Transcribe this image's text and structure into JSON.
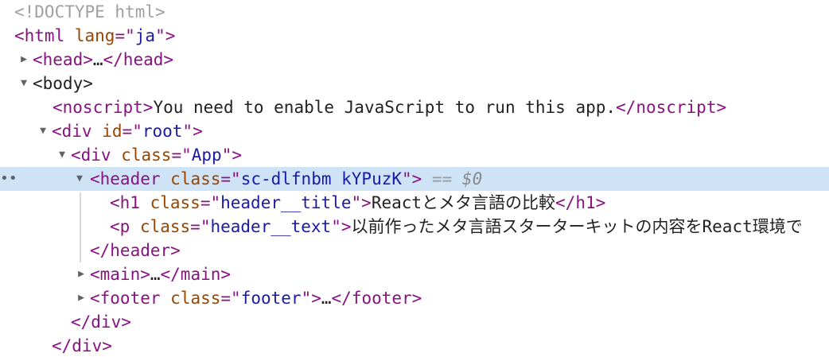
{
  "doctype": "<!DOCTYPE html>",
  "html_open": {
    "tag": "<html",
    "attr": "lang",
    "val": "ja",
    "close": ">"
  },
  "head": {
    "open": "<head>",
    "ellipsis": "…",
    "close": "</head>"
  },
  "body_open": "<body>",
  "noscript": {
    "open": "<noscript>",
    "text": "You need to enable JavaScript to run this app.",
    "close": "</noscript>"
  },
  "div_root": {
    "tag": "<div",
    "attr": "id",
    "val": "root",
    "close": ">"
  },
  "div_app": {
    "tag": "<div",
    "attr": "class",
    "val": "App",
    "close": ">"
  },
  "header": {
    "tag": "<header",
    "attr": "class",
    "val": "sc-dlfnbm kYPuzK",
    "close": ">",
    "eq": "==",
    "dollar": "$0",
    "dots": "••",
    "h1": {
      "tag": "<h1",
      "attr": "class",
      "val": "header__title",
      "gt": ">",
      "text": "Reactとメタ言語の比較",
      "close": "</h1>"
    },
    "p": {
      "tag": "<p",
      "attr": "class",
      "val": "header__text",
      "gt": ">",
      "text": "以前作ったメタ言語スターターキットの内容をReact環境で"
    },
    "end": "</header>"
  },
  "main": {
    "open": "<main>",
    "ellipsis": "…",
    "close": "</main>"
  },
  "footer": {
    "tag": "<footer",
    "attr": "class",
    "val": "footer",
    "gt": ">",
    "ellipsis": "…",
    "close": "</footer>"
  },
  "div_close_inner": "</div>",
  "div_close_outer": "</div>",
  "attr_syntax": {
    "eq": "=",
    "quote": "\""
  }
}
